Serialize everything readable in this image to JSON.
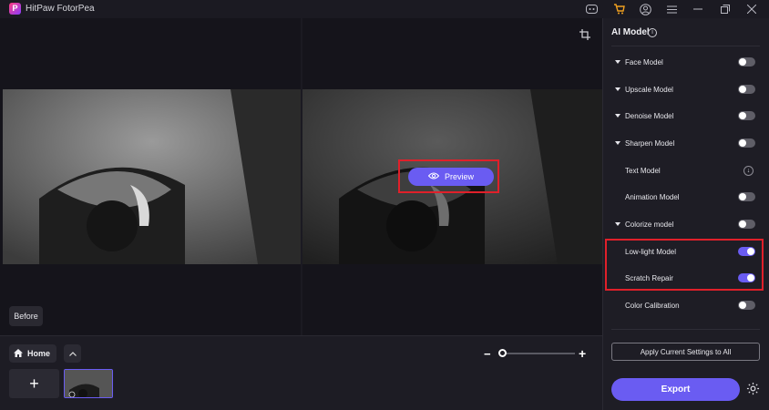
{
  "titlebar": {
    "logo_letter": "P",
    "app_title": "HitPaw FotorPea",
    "icons": [
      "discord-icon",
      "cart-icon",
      "account-icon",
      "menu-icon",
      "minimize-icon",
      "restore-icon",
      "close-icon"
    ]
  },
  "canvas": {
    "preview_label": "Preview",
    "before_label": "Before"
  },
  "bottom": {
    "home_label": "Home",
    "zoom_minus": "−",
    "zoom_plus": "+",
    "add_label": "+"
  },
  "panel": {
    "title": "AI Model",
    "models": [
      {
        "label": "Face Model",
        "expandable": true,
        "control": "toggle",
        "on": false
      },
      {
        "label": "Upscale Model",
        "expandable": true,
        "control": "toggle",
        "on": false
      },
      {
        "label": "Denoise Model",
        "expandable": true,
        "control": "toggle",
        "on": false
      },
      {
        "label": "Sharpen Model",
        "expandable": true,
        "control": "toggle",
        "on": false
      },
      {
        "label": "Text Model",
        "expandable": false,
        "control": "download",
        "on": false
      },
      {
        "label": "Animation Model",
        "expandable": false,
        "control": "toggle",
        "on": false
      },
      {
        "label": "Colorize model",
        "expandable": true,
        "control": "toggle",
        "on": false
      },
      {
        "label": "Low-light Model",
        "expandable": false,
        "control": "toggle",
        "on": true
      },
      {
        "label": "Scratch Repair",
        "expandable": false,
        "control": "toggle",
        "on": true
      },
      {
        "label": "Color Calibration",
        "expandable": false,
        "control": "toggle",
        "on": false
      }
    ],
    "apply_label": "Apply Current Settings to All",
    "export_label": "Export"
  },
  "colors": {
    "accent": "#6a5cf2",
    "highlight": "#e0202a"
  }
}
